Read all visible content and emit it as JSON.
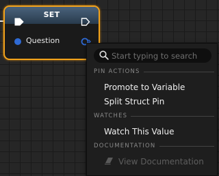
{
  "node": {
    "title": "SET",
    "pin_label": "Question",
    "colors": {
      "border": "#f3a31b",
      "header": "#3c546b",
      "pin": "#2f6ad4"
    }
  },
  "menu": {
    "search": {
      "placeholder": "Start typing to search",
      "value": ""
    },
    "sections": [
      {
        "label": "PIN ACTIONS",
        "items": [
          "Promote to Variable",
          "Split Struct Pin"
        ]
      },
      {
        "label": "WATCHES",
        "items": [
          "Watch This Value"
        ]
      },
      {
        "label": "DOCUMENTATION",
        "items": [
          "View Documentation"
        ]
      }
    ],
    "disabled_items": [
      "View Documentation"
    ]
  },
  "icons": {
    "search": "search-icon",
    "exec_in": "exec-pin-icon",
    "exec_out": "exec-pin-icon",
    "variable_pin_in": "variable-pin-icon",
    "variable_pin_out": "variable-pin-icon",
    "documentation": "documentation-book-icon"
  }
}
